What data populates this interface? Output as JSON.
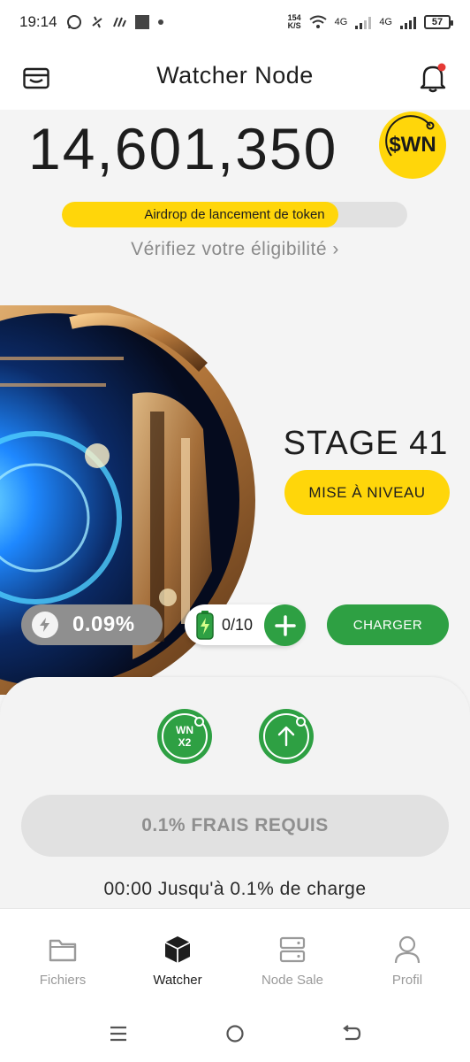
{
  "status_bar": {
    "time": "19:14",
    "speed_value": "154",
    "speed_unit": "K/S",
    "net1": "4G",
    "net2": "4G",
    "battery": "57"
  },
  "header": {
    "title": "Watcher Node",
    "left_icon": "wallet-icon",
    "right_icon": "bell-icon"
  },
  "balance": {
    "amount": "14,601,350",
    "token": "$WN"
  },
  "airdrop": {
    "label": "Airdrop de lancement de token",
    "progress_fraction": 0.8,
    "eligibility_link": "Vérifiez votre éligibilité ›"
  },
  "node": {
    "stage": "STAGE 41",
    "upgrade_label": "MISE À NIVEAU"
  },
  "stats": {
    "rate": "0.09%",
    "battery_count": "0/10",
    "charge_label": "CHARGER"
  },
  "boosts": {
    "x2_line1": "WN",
    "x2_line2": "X2"
  },
  "actions": {
    "fee_label": "0.1% FRAIS REQUIS",
    "countdown": "00:00 Jusqu'à 0.1% de charge"
  },
  "nav": {
    "items": [
      {
        "label": "Fichiers",
        "icon": "folder-icon"
      },
      {
        "label": "Watcher",
        "icon": "cube-icon"
      },
      {
        "label": "Node Sale",
        "icon": "server-icon"
      },
      {
        "label": "Profil",
        "icon": "user-icon"
      }
    ],
    "active_index": 1
  },
  "colors": {
    "accent_yellow": "#ffd60a",
    "accent_green": "#2ea043",
    "background": "#f4f4f4"
  }
}
